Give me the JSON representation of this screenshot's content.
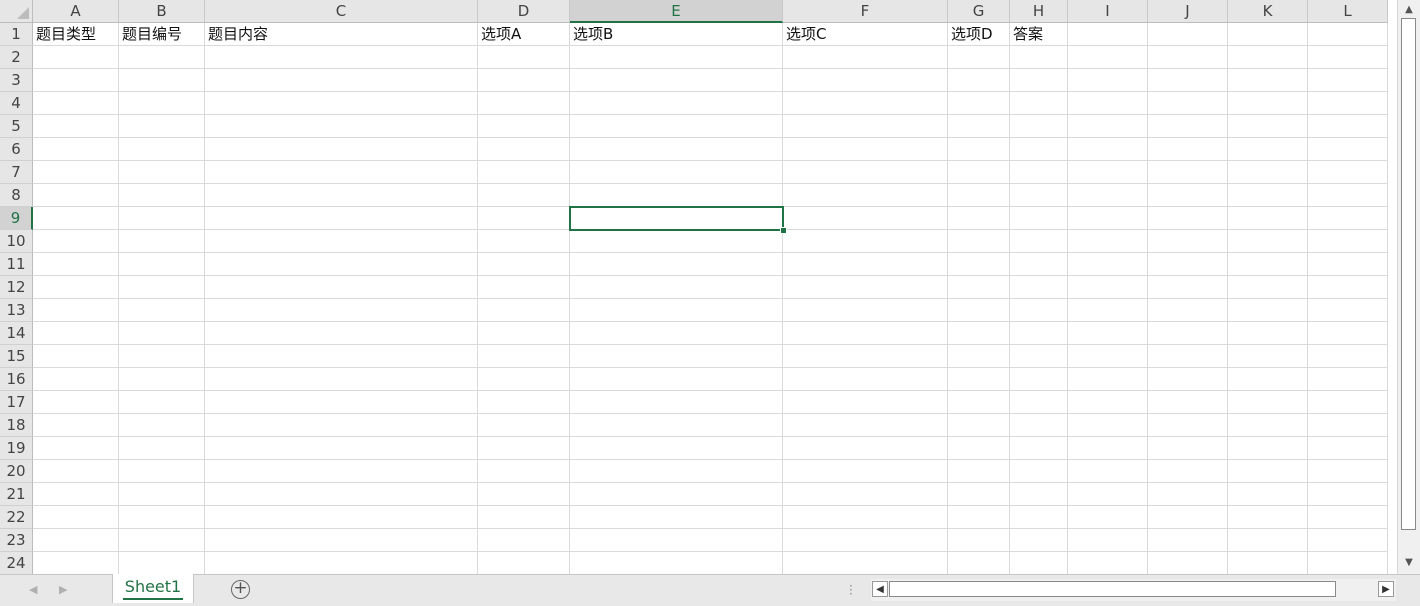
{
  "columns": [
    "A",
    "B",
    "C",
    "D",
    "E",
    "F",
    "G",
    "H",
    "I",
    "J",
    "K",
    "L"
  ],
  "active_column": "E",
  "rows": [
    "1",
    "2",
    "3",
    "4",
    "5",
    "6",
    "7",
    "8",
    "9",
    "10",
    "11",
    "12",
    "13",
    "14",
    "15",
    "16",
    "17",
    "18",
    "19",
    "20",
    "21",
    "22",
    "23",
    "24"
  ],
  "active_row": "9",
  "cells": {
    "A1": "题目类型",
    "B1": "题目编号",
    "C1": "题目内容",
    "D1": "选项A",
    "E1": "选项B",
    "F1": "选项C",
    "G1": "选项D",
    "H1": "答案"
  },
  "selected_cell": "E9",
  "sheet_tabs": [
    {
      "label": "Sheet1",
      "active": true
    }
  ],
  "add_sheet_label": "+",
  "colors": {
    "accent": "#217346"
  },
  "icons": {
    "select_all": "select-all-triangle-icon",
    "nav_prev": "chevron-left-icon",
    "nav_next": "chevron-right-icon",
    "add_sheet": "plus-circle-icon",
    "scroll_up": "triangle-up-icon",
    "scroll_down": "triangle-down-icon",
    "scroll_left": "triangle-left-icon",
    "scroll_right": "triangle-right-icon"
  }
}
